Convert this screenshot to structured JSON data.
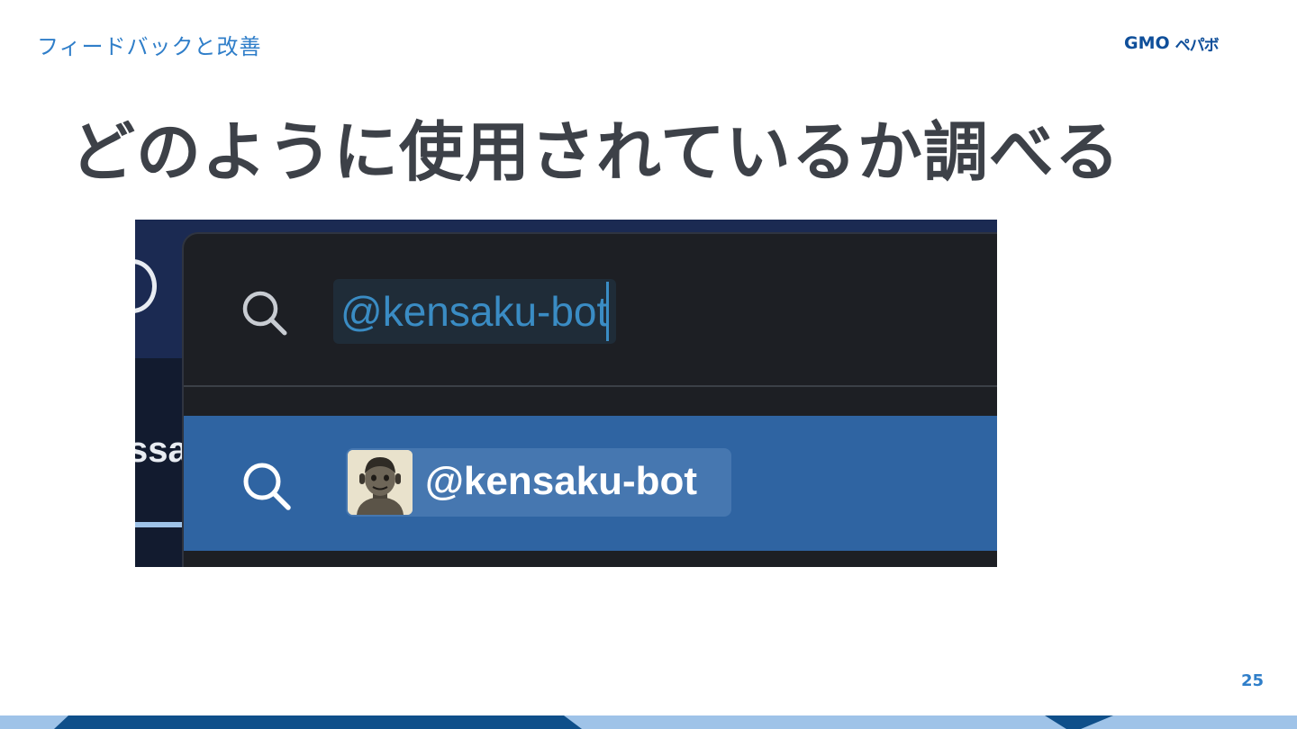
{
  "header": {
    "section": "フィードバックと改善",
    "logo_gmo": "GMO",
    "logo_kana": "ペパボ"
  },
  "title": "どのように使用されているか調べる",
  "screenshot": {
    "left_partial_text": "ssa",
    "search_query": "@kensaku-bot",
    "result_label": "@kensaku-bot"
  },
  "footer": {
    "page_number": "25"
  },
  "colors": {
    "accent_blue": "#2f7ec9",
    "title_gray": "#3d4148",
    "brand_navy": "#0f4f9a",
    "band_light": "#9fc3e8",
    "band_dark": "#0f4f8a",
    "result_row": "#2f64a2",
    "panel_dark": "#1d1f24"
  },
  "icons": {
    "search": "search-icon",
    "avatar": "bot-avatar-icon"
  }
}
